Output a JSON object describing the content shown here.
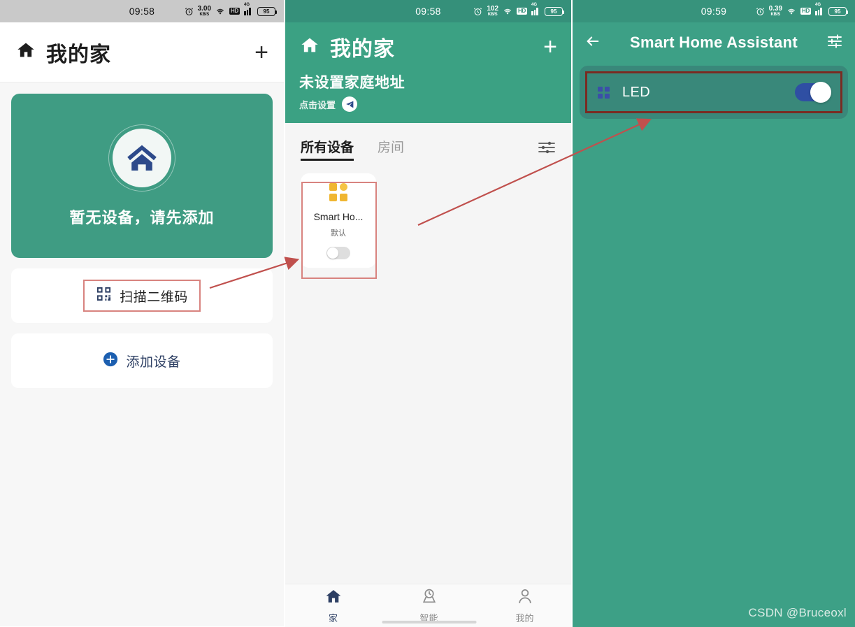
{
  "panel1": {
    "statusbar": {
      "time": "09:58",
      "alarm_icon": "alarm-clock-icon",
      "netspeed_value": "3.00",
      "netspeed_unit": "KB/S",
      "wifi_icon": "wifi-icon",
      "hd_badge": "HD",
      "signal_label": "4G",
      "battery": "95"
    },
    "appbar": {
      "home_icon": "home-icon",
      "title": "我的家",
      "add_label": "+"
    },
    "hero": {
      "logo_icon": "home-logo-icon",
      "text": "暂无设备，请先添加"
    },
    "rows": [
      {
        "icon": "qr-code-icon",
        "label": "扫描二维码",
        "highlighted": true
      },
      {
        "icon": "plus-circle-icon",
        "label": "添加设备",
        "highlighted": false
      }
    ]
  },
  "panel2": {
    "statusbar": {
      "time": "09:58",
      "alarm_icon": "alarm-clock-icon",
      "netspeed_value": "102",
      "netspeed_unit": "KB/S",
      "wifi_icon": "wifi-icon",
      "hd_badge": "HD",
      "signal_label": "4G",
      "battery": "95"
    },
    "header": {
      "home_icon": "home-icon",
      "title": "我的家",
      "add_label": "+",
      "address": "未设置家庭地址",
      "subtitle": "点击设置",
      "send_icon": "send-icon"
    },
    "tabs": [
      {
        "label": "所有设备",
        "active": true
      },
      {
        "label": "房间",
        "active": false
      }
    ],
    "filter_icon": "filter-sliders-icon",
    "devices": [
      {
        "icon": "grid-tiles-icon",
        "name": "Smart Ho...",
        "room": "默认",
        "toggle": "off"
      }
    ],
    "bottomnav": [
      {
        "icon": "home-icon",
        "label": "家",
        "active": true
      },
      {
        "icon": "smart-scene-icon",
        "label": "智能",
        "active": false
      },
      {
        "icon": "person-icon",
        "label": "我的",
        "active": false
      }
    ]
  },
  "panel3": {
    "statusbar": {
      "time": "09:59",
      "alarm_icon": "alarm-clock-icon",
      "netspeed_value": "0.39",
      "netspeed_unit": "KB/S",
      "wifi_icon": "wifi-icon",
      "hd_badge": "HD",
      "signal_label": "4G",
      "battery": "95"
    },
    "appbar": {
      "back_icon": "arrow-left-icon",
      "title": "Smart Home Assistant",
      "settings_icon": "sliders-settings-icon"
    },
    "device": {
      "icon": "grid-tiles-icon",
      "name": "LED",
      "toggle": "on"
    },
    "watermark": "CSDN @Bruceoxl"
  },
  "colors": {
    "brand_green": "#3f9c83",
    "header_green": "#3ba183",
    "panel3_green": "#3da086",
    "card_green": "#39887a",
    "navy": "#2d3f63",
    "toggle_on": "#2f4fa3",
    "accent_orange": "#f0b631",
    "highlight_red": "#d8837f",
    "highlight_dark_red": "#7a2b22",
    "arrow_red": "#c0504d"
  }
}
